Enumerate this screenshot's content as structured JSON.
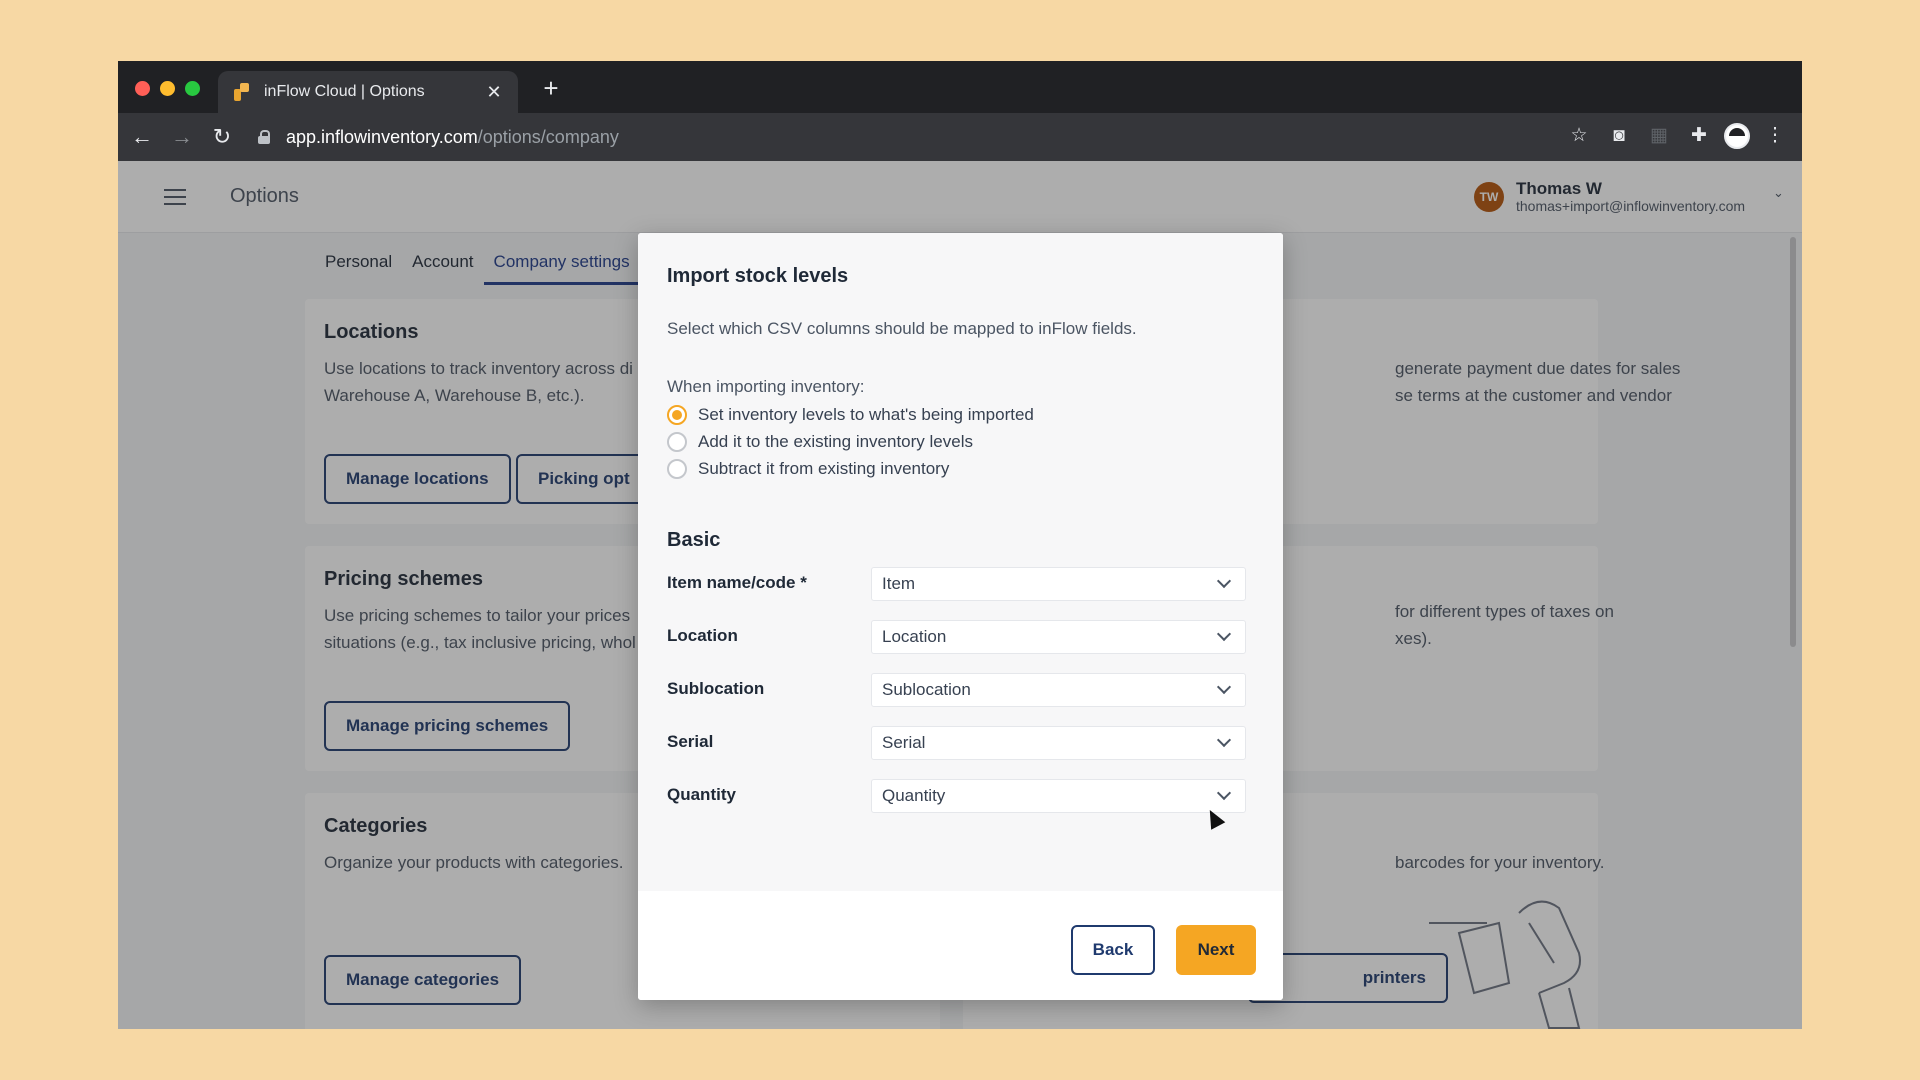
{
  "browser": {
    "tab_title": "inFlow Cloud | Options",
    "tab_close": "✕",
    "new_tab": "+",
    "url_host": "app.inflowinventory.com",
    "url_path": "/options/company",
    "back": "←",
    "forward": "→",
    "reload": "↻",
    "icons": [
      "bookmark-star-icon",
      "camera-icon",
      "extension-icon",
      "puzzle-icon",
      "profile-icon",
      "kebab-menu-icon"
    ]
  },
  "header": {
    "title": "Options",
    "user_initials": "TW",
    "user_name": "Thomas W",
    "user_email": "thomas+import@inflowinventory.com"
  },
  "settings_tabs": [
    {
      "label": "Personal"
    },
    {
      "label": "Account"
    },
    {
      "label": "Company settings"
    }
  ],
  "cards": {
    "locations": {
      "title": "Locations",
      "desc_line1": "Use locations to track inventory across di",
      "desc_line2": "Warehouse A, Warehouse B, etc.).",
      "btn_manage": "Manage locations",
      "btn_picking": "Picking opt"
    },
    "payment_terms": {
      "desc_line1": "generate payment due dates for sales",
      "desc_line2": "se terms at the customer and vendor"
    },
    "pricing": {
      "title": "Pricing schemes",
      "desc_line1": "Use pricing schemes to tailor your prices",
      "desc_line2": "situations (e.g., tax inclusive pricing, whol",
      "btn_manage": "Manage pricing schemes"
    },
    "taxes": {
      "desc_line1": "for different types of taxes on",
      "desc_line2": "xes)."
    },
    "categories": {
      "title": "Categories",
      "desc_line1": "Organize your products with categories.",
      "btn_manage": "Manage categories"
    },
    "barcodes": {
      "desc_line1": "barcodes for your inventory.",
      "btn_printers": "printers"
    }
  },
  "modal": {
    "title": "Import stock levels",
    "subtitle": "Select which CSV columns should be mapped to inFlow fields.",
    "when_label": "When importing inventory:",
    "options": [
      {
        "label": "Set inventory levels to what's being imported",
        "checked": true
      },
      {
        "label": "Add it to the existing inventory levels",
        "checked": false
      },
      {
        "label": "Subtract it from existing inventory",
        "checked": false
      }
    ],
    "section_title": "Basic",
    "fields": [
      {
        "label": "Item name/code *",
        "value": "Item"
      },
      {
        "label": "Location",
        "value": "Location"
      },
      {
        "label": "Sublocation",
        "value": "Sublocation"
      },
      {
        "label": "Serial",
        "value": "Serial"
      },
      {
        "label": "Quantity",
        "value": "Quantity"
      }
    ],
    "back_label": "Back",
    "next_label": "Next"
  },
  "colors": {
    "accent": "#f5a623",
    "navy": "#1f3a6e",
    "backdrop": "#f7d8a4"
  }
}
